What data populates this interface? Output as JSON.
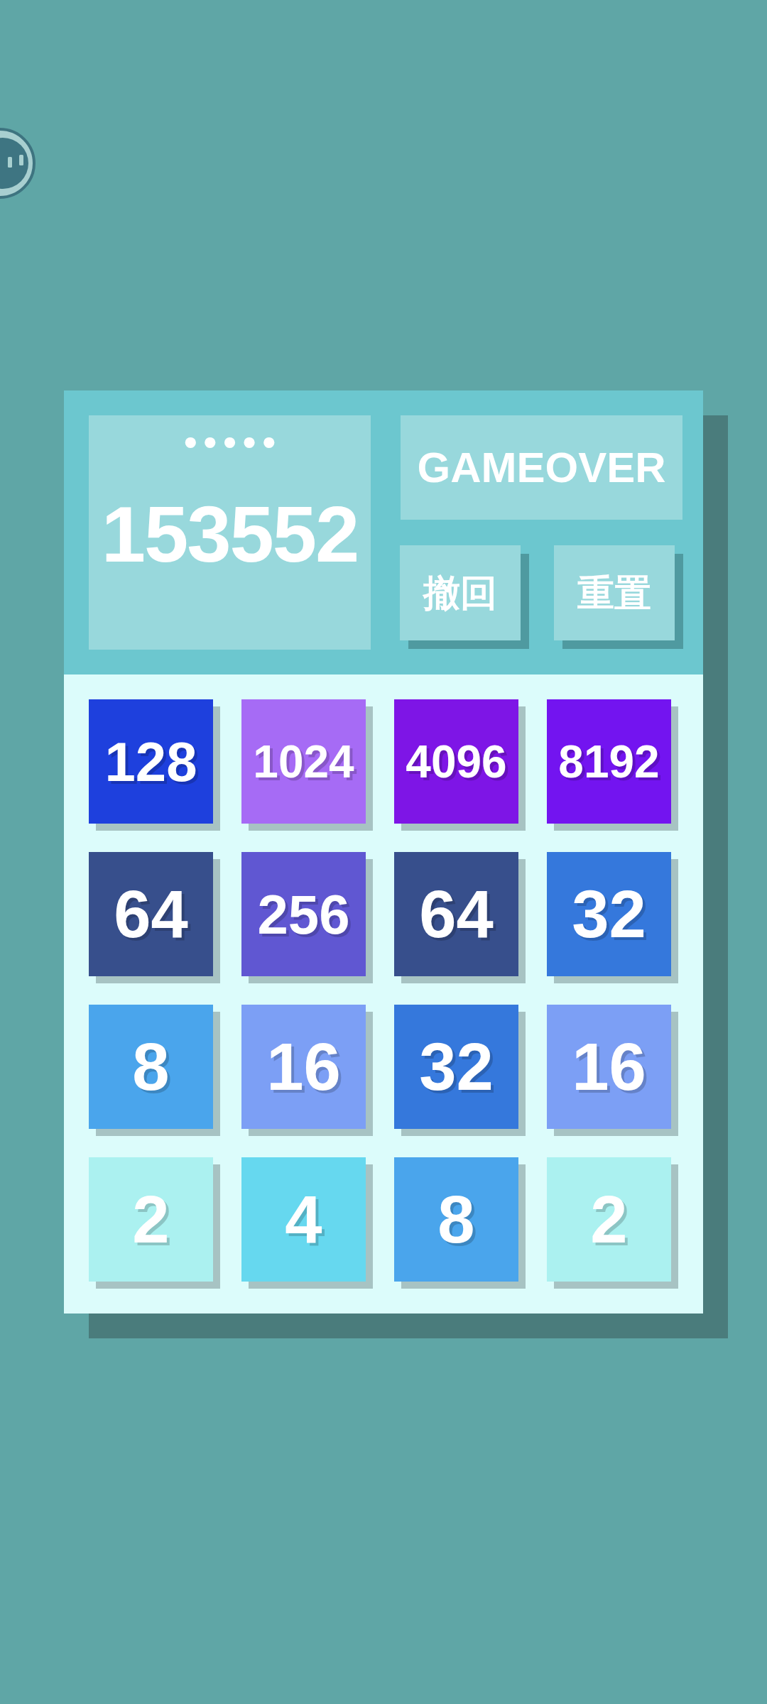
{
  "score_panel": {
    "player": "•••••",
    "score": "153552"
  },
  "status": "GAMEOVER",
  "buttons": [
    {
      "label": "撤回"
    },
    {
      "label": "重置"
    }
  ],
  "board": {
    "rows": [
      {
        "tiles": [
          {
            "value": "128",
            "color": "#1e40dd"
          },
          {
            "value": "1024",
            "color": "#a66bf5"
          },
          {
            "value": "4096",
            "color": "#7e15e6"
          },
          {
            "value": "8192",
            "color": "#7314f0"
          }
        ]
      },
      {
        "tiles": [
          {
            "value": "64",
            "color": "#374f8c"
          },
          {
            "value": "256",
            "color": "#6057d2"
          },
          {
            "value": "64",
            "color": "#374f8c"
          },
          {
            "value": "32",
            "color": "#3578dc"
          }
        ]
      },
      {
        "tiles": [
          {
            "value": "8",
            "color": "#4aa5ec"
          },
          {
            "value": "16",
            "color": "#7c9ff5"
          },
          {
            "value": "32",
            "color": "#3578dc"
          },
          {
            "value": "16",
            "color": "#7c9ff5"
          }
        ]
      },
      {
        "tiles": [
          {
            "value": "2",
            "color": "#abf1f0"
          },
          {
            "value": "4",
            "color": "#66d8ef"
          },
          {
            "value": "8",
            "color": "#4aa5ec"
          },
          {
            "value": "2",
            "color": "#abf1f0"
          }
        ]
      }
    ]
  }
}
